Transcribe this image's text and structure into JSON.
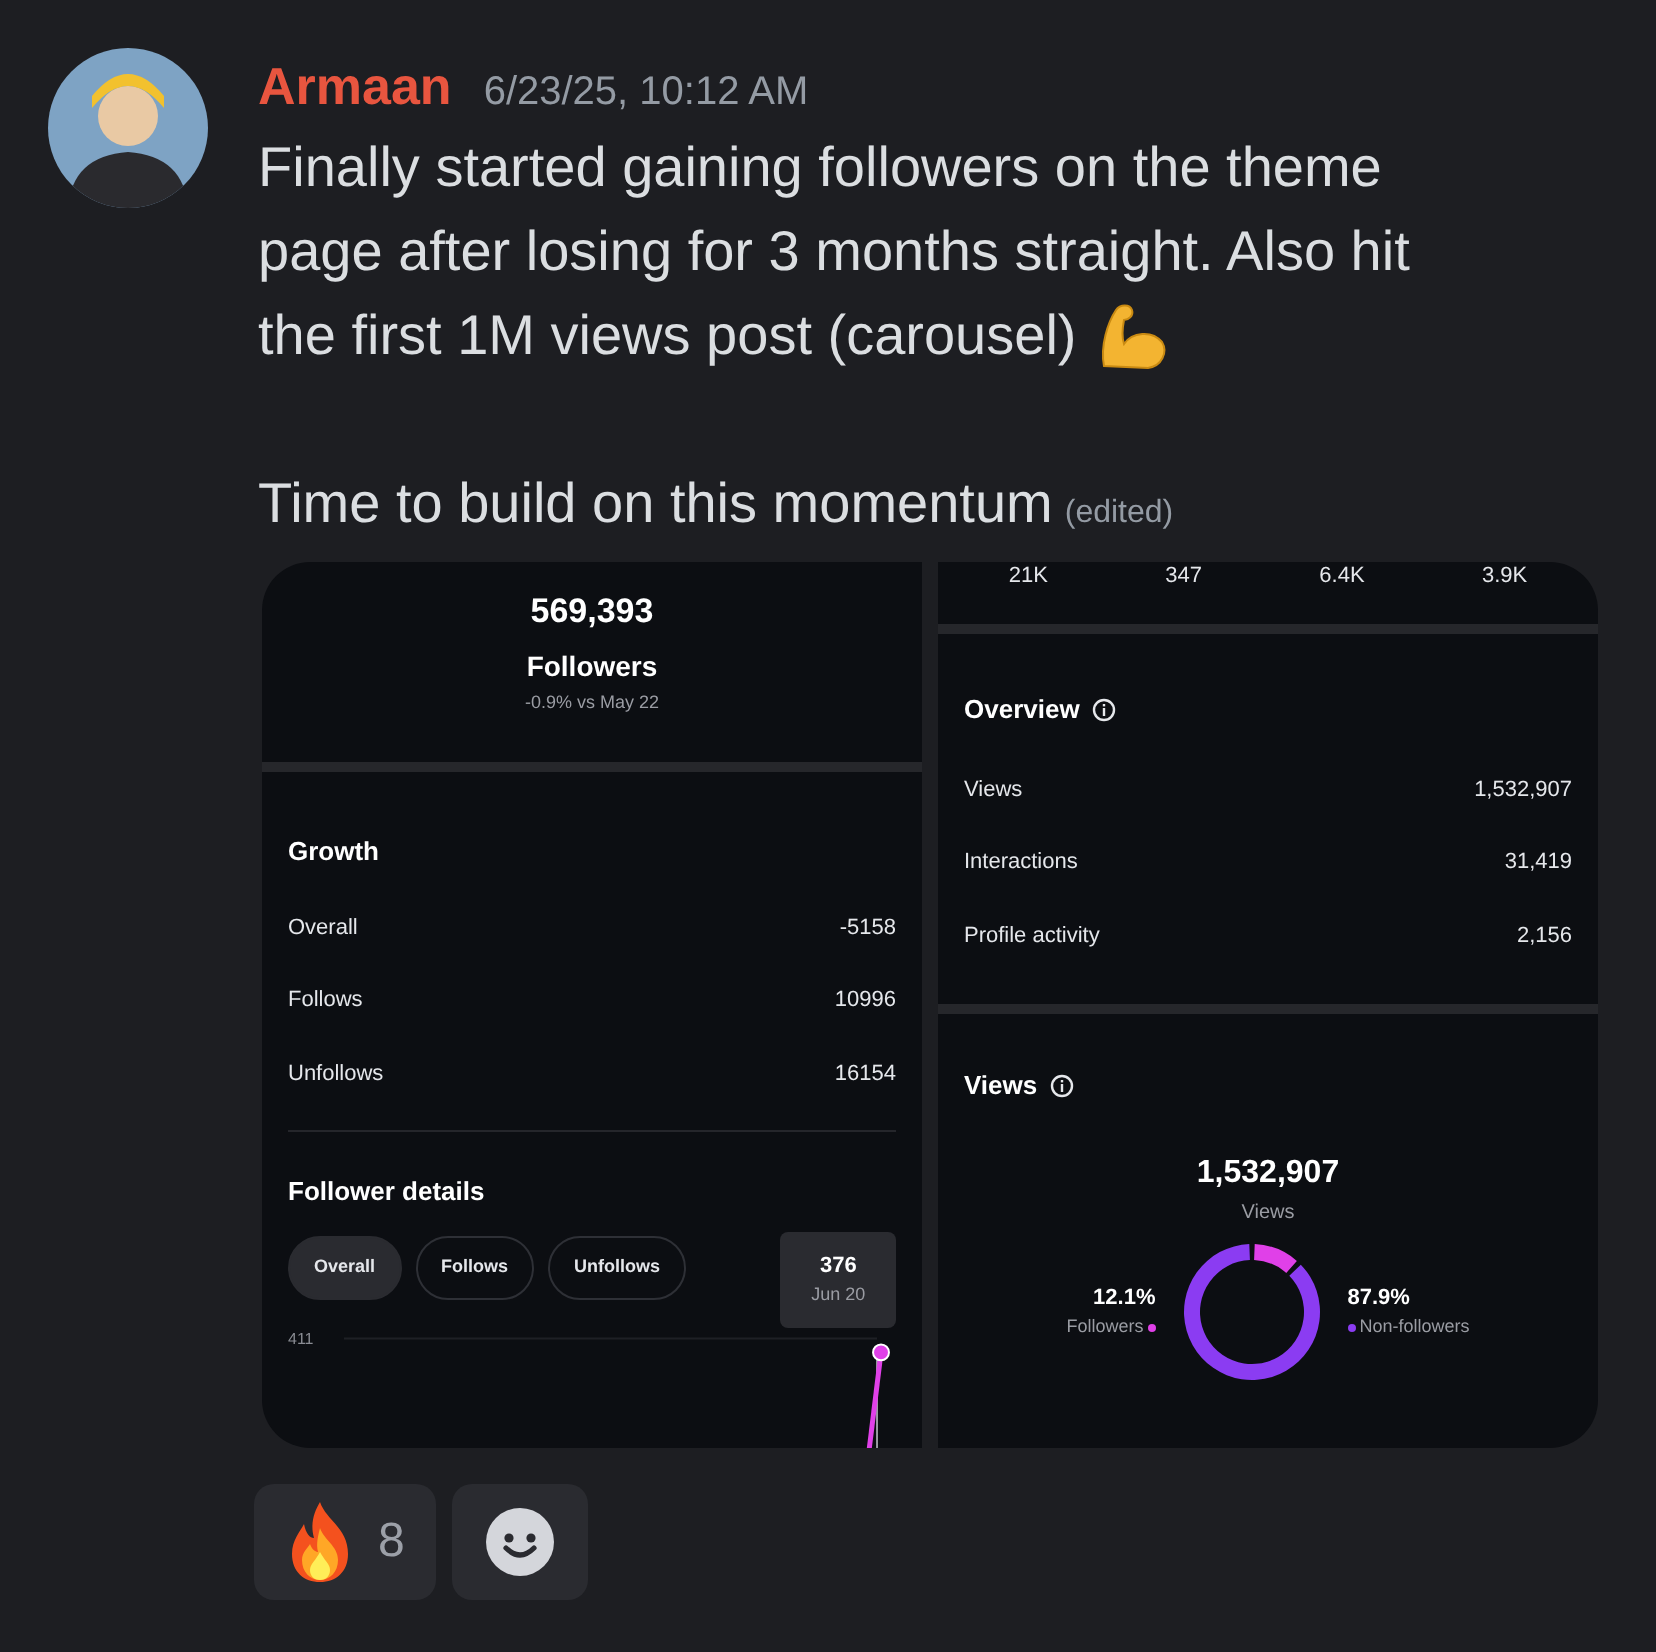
{
  "message": {
    "author": "Armaan",
    "timestamp": "6/23/25, 10:12 AM",
    "lines": [
      "Finally started gaining followers on the theme",
      "page after losing for 3 months straight. Also hit",
      "the first 1M views post (carousel)"
    ],
    "second_paragraph": "Time to build on this momentum",
    "edited": "(edited)"
  },
  "left_screenshot": {
    "followers_count": "569,393",
    "followers_label": "Followers",
    "change": "-0.9% vs May 22",
    "growth": {
      "title": "Growth",
      "rows": [
        {
          "label": "Overall",
          "value": "-5158"
        },
        {
          "label": "Follows",
          "value": "10996"
        },
        {
          "label": "Unfollows",
          "value": "16154"
        }
      ]
    },
    "follower_details": {
      "title": "Follower details",
      "filters": [
        {
          "label": "Overall",
          "selected": true
        },
        {
          "label": "Follows",
          "selected": false
        },
        {
          "label": "Unfollows",
          "selected": false
        }
      ],
      "y_tick": "411",
      "tooltip": {
        "value": "376",
        "date": "Jun 20"
      }
    }
  },
  "right_screenshot": {
    "top_stats": [
      "21K",
      "347",
      "6.4K",
      "3.9K"
    ],
    "overview": {
      "title": "Overview",
      "rows": [
        {
          "label": "Views",
          "value": "1,532,907"
        },
        {
          "label": "Interactions",
          "value": "31,419"
        },
        {
          "label": "Profile activity",
          "value": "2,156"
        }
      ]
    },
    "views": {
      "title": "Views",
      "total": "1,532,907",
      "total_label": "Views",
      "legend": [
        {
          "percent": "12.1%",
          "color": "#e040e8"
        },
        {
          "percent": "87.9%",
          "color": "#8b3cf2"
        }
      ],
      "chart_data": {
        "type": "donut",
        "categories": [
          "Followers",
          "Non-followers"
        ],
        "values": [
          12.1,
          87.9
        ]
      }
    }
  },
  "reactions": [
    {
      "kind": "fire",
      "count": "8"
    },
    {
      "kind": "add"
    }
  ]
}
